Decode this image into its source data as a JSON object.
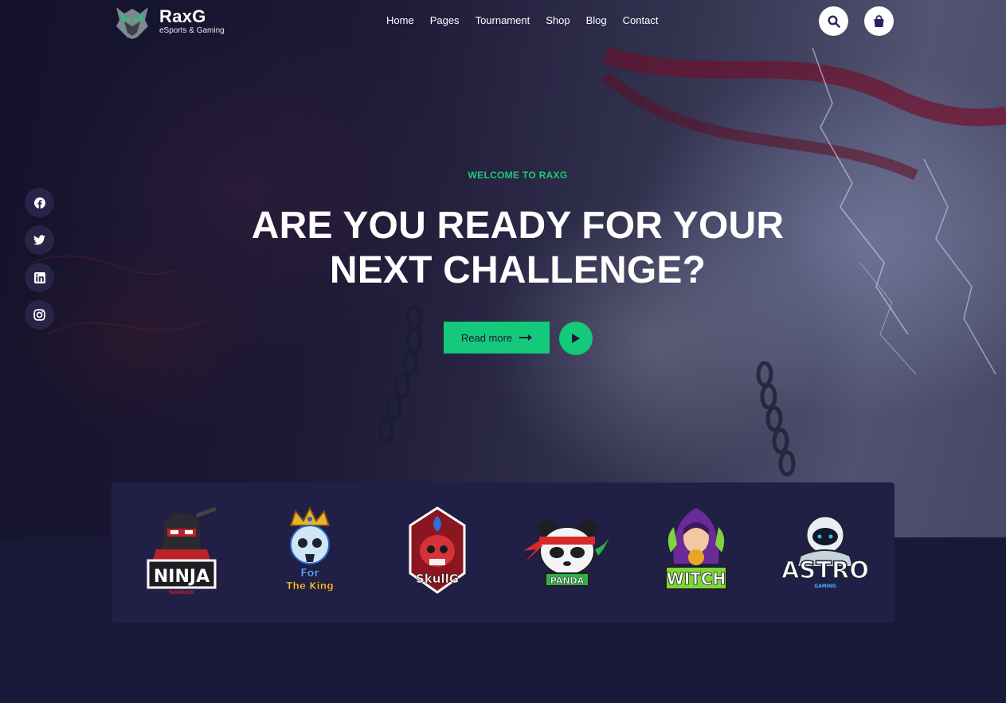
{
  "brand": {
    "name": "RaxG",
    "tagline": "eSports & Gaming"
  },
  "nav": {
    "items": [
      "Home",
      "Pages",
      "Tournament",
      "Shop",
      "Blog",
      "Contact"
    ]
  },
  "header_icons": [
    "search-icon",
    "shopping-bag-icon"
  ],
  "social": [
    "facebook-icon",
    "twitter-icon",
    "linkedin-icon",
    "instagram-icon"
  ],
  "hero": {
    "kicker": "WELCOME TO RAXG",
    "headline_line1": "ARE YOU READY FOR YOUR",
    "headline_line2": "NEXT CHALLENGE?",
    "cta_label": "Read more"
  },
  "sponsors": [
    {
      "name": "NINJA",
      "sub": "WARRIOR"
    },
    {
      "name": "For The King"
    },
    {
      "name": "SkullG"
    },
    {
      "name": "PANDA"
    },
    {
      "name": "WITCH"
    },
    {
      "name": "ASTRO",
      "sub": "GAMING"
    }
  ],
  "colors": {
    "accent": "#14c97a",
    "background": "#1a1838",
    "panel": "#211f45"
  }
}
